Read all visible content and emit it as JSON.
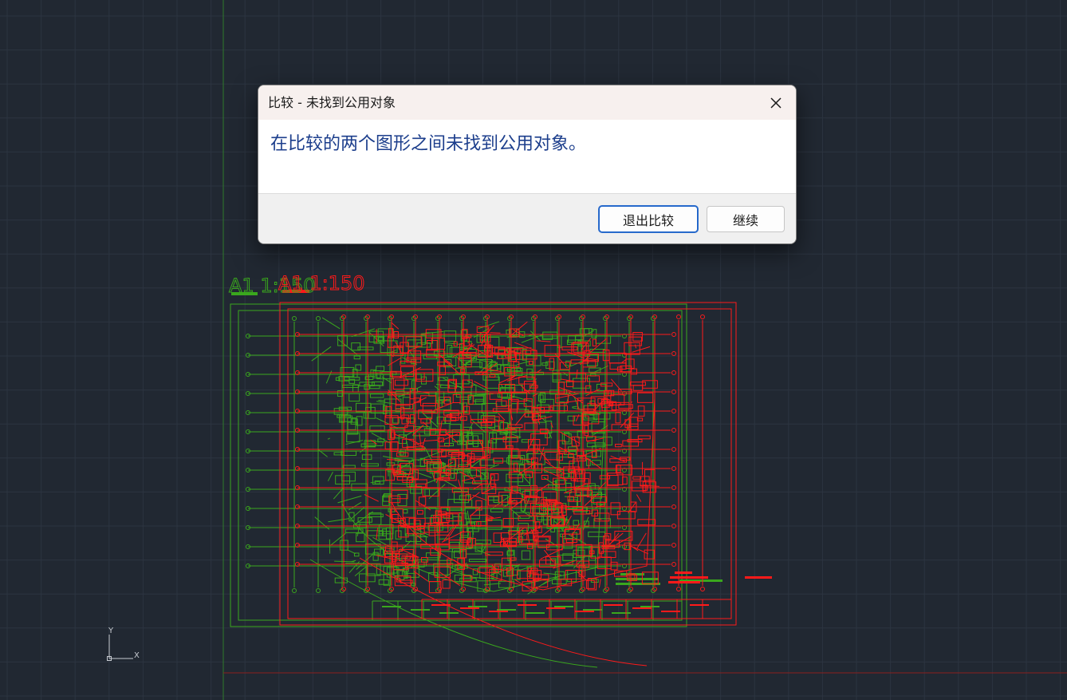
{
  "dialog": {
    "title": "比较 - 未找到公用对象",
    "message": "在比较的两个图形之间未找到公用对象。",
    "buttons": {
      "exit_compare": "退出比较",
      "continue": "继续"
    },
    "close_icon": "close-icon"
  },
  "drawing": {
    "labels": {
      "green_scale": "A1  1:150",
      "red_scale": "A1  1:150"
    },
    "colors": {
      "background": "#212832",
      "grid": "#2c3440",
      "drawing_a": "#3aa71d",
      "drawing_b": "#ff1a1a",
      "axis_green": "#2f7a2a",
      "axis_red": "#8a1f1f"
    }
  },
  "ucs": {
    "x_label": "X",
    "y_label": "Y",
    "icon": "ucs-axes-icon"
  }
}
